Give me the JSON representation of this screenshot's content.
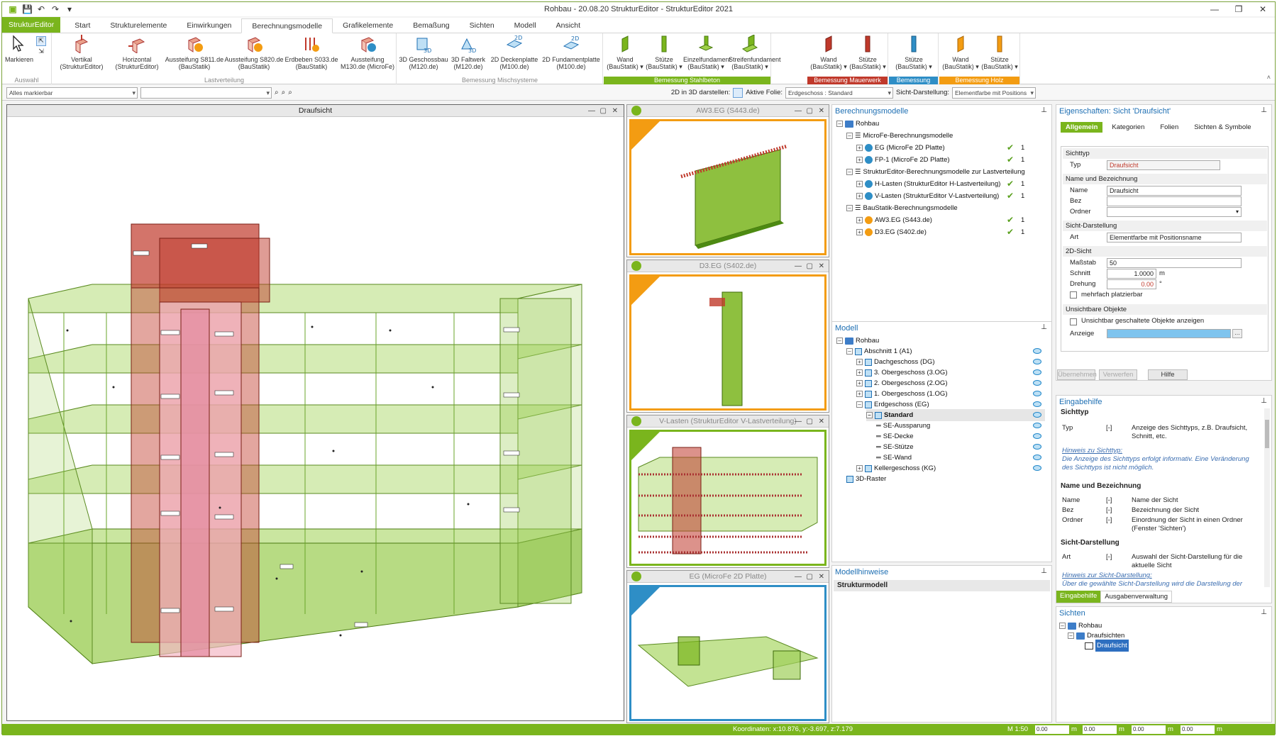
{
  "window": {
    "title": "Rohbau - 20.08.20 StrukturEditor - StrukturEditor 2021",
    "controls": [
      "—",
      "❐",
      "✕"
    ]
  },
  "quick_access": {
    "save_icon": "save-icon",
    "undo_icon": "undo-icon",
    "redo_icon": "redo-icon",
    "customize_icon": "customize-icon"
  },
  "tabs": [
    "StrukturEditor",
    "Start",
    "Strukturelemente",
    "Einwirkungen",
    "Berechnungsmodelle",
    "Grafikelemente",
    "Bemaßung",
    "Sichten",
    "Modell",
    "Ansicht"
  ],
  "active_tab": "Berechnungsmodelle",
  "ribbon": {
    "auswahl": {
      "label": "Auswahl",
      "markieren": "Markieren"
    },
    "lastverteilung": {
      "label": "Lastverteilung",
      "buttons": [
        {
          "l1": "Vertikal",
          "l2": "(StrukturEditor)"
        },
        {
          "l1": "Horizontal",
          "l2": "(StrukturEditor)"
        },
        {
          "l1": "Aussteifung S811.de",
          "l2": "(BauStatik)"
        },
        {
          "l1": "Aussteifung S820.de",
          "l2": "(BauStatik)"
        },
        {
          "l1": "Erdbeben S033.de",
          "l2": "(BauStatik)"
        },
        {
          "l1": "Aussteifung",
          "l2": "M130.de (MicroFe)"
        }
      ]
    },
    "mischsysteme": {
      "label": "Bemessung Mischsysteme",
      "buttons": [
        {
          "l1": "3D Geschossbau",
          "l2": "(M120.de)"
        },
        {
          "l1": "3D Faltwerk",
          "l2": "(M120.de)"
        },
        {
          "l1": "2D Deckenplatte",
          "l2": "(M100.de)"
        },
        {
          "l1": "2D Fundamentplatte",
          "l2": "(M100.de)"
        }
      ]
    },
    "stahlbeton": {
      "label": "Bemessung Stahlbeton",
      "color": "#7ab51d",
      "buttons": [
        {
          "l1": "Wand",
          "l2": "(BauStatik) ▾"
        },
        {
          "l1": "Stütze",
          "l2": "(BauStatik) ▾"
        },
        {
          "l1": "Einzelfundament",
          "l2": "(BauStatik) ▾"
        },
        {
          "l1": "Streifenfundament",
          "l2": "(BauStatik) ▾"
        }
      ]
    },
    "mauerwerk": {
      "label": "Bemessung Mauerwerk",
      "color": "#c0392b",
      "buttons": [
        {
          "l1": "Wand",
          "l2": "(BauStatik) ▾"
        },
        {
          "l1": "Stütze",
          "l2": "(BauStatik) ▾"
        }
      ]
    },
    "stahl": {
      "label": "Bemessung Stahl",
      "color": "#2e8ec6",
      "buttons": [
        {
          "l1": "Stütze",
          "l2": "(BauStatik) ▾"
        }
      ]
    },
    "holz": {
      "label": "Bemessung Holz",
      "color": "#f39c12",
      "buttons": [
        {
          "l1": "Wand",
          "l2": "(BauStatik) ▾"
        },
        {
          "l1": "Stütze",
          "l2": "(BauStatik) ▾"
        }
      ]
    }
  },
  "toolbar": {
    "selection_combo": "Alles markierbar",
    "second_combo": "",
    "show_3d": "2D in 3D darstellen:",
    "active_layer_label": "Aktive Folie:",
    "active_layer_value": "Erdgeschoss : Standard",
    "view_mode_label": "Sicht-Darstellung:",
    "view_mode_value": "Elementfarbe mit Positions"
  },
  "main_view": {
    "title": "Draufsicht"
  },
  "mini_views": [
    {
      "title": "AW3.EG (S443.de)",
      "accent": "#f39c12"
    },
    {
      "title": "D3.EG (S402.de)",
      "accent": "#f39c12"
    },
    {
      "title": "V-Lasten (StrukturEditor V-Lastverteilung)",
      "accent": "#7ab51d"
    },
    {
      "title": "EG (MicroFe 2D Platte)",
      "accent": "#2e8ec6"
    }
  ],
  "berechnungsmodelle": {
    "title": "Berechnungsmodelle",
    "rows": [
      {
        "label": "Rohbau",
        "indent": 0,
        "checked": false,
        "count": ""
      },
      {
        "label": "MicroFe-Berechnungsmodelle",
        "indent": 1,
        "checked": false,
        "count": ""
      },
      {
        "label": "EG (MicroFe 2D Platte)",
        "indent": 2,
        "checked": true,
        "count": "1"
      },
      {
        "label": "FP-1 (MicroFe 2D Platte)",
        "indent": 2,
        "checked": true,
        "count": "1"
      },
      {
        "label": "StrukturEditor-Berechnungsmodelle zur Lastverteilung",
        "indent": 1,
        "checked": false,
        "count": ""
      },
      {
        "label": "H-Lasten (StrukturEditor H-Lastverteilung)",
        "indent": 2,
        "checked": true,
        "count": "1"
      },
      {
        "label": "V-Lasten (StrukturEditor V-Lastverteilung)",
        "indent": 2,
        "checked": true,
        "count": "1"
      },
      {
        "label": "BauStatik-Berechnungsmodelle",
        "indent": 1,
        "checked": false,
        "count": ""
      },
      {
        "label": "AW3.EG (S443.de)",
        "indent": 2,
        "checked": true,
        "count": "1"
      },
      {
        "label": "D3.EG (S402.de)",
        "indent": 2,
        "checked": true,
        "count": "1"
      }
    ]
  },
  "modell": {
    "title": "Modell",
    "rows": [
      {
        "label": "Rohbau",
        "indent": 0
      },
      {
        "label": "Abschnitt 1 (A1)",
        "indent": 1
      },
      {
        "label": "Dachgeschoss (DG)",
        "indent": 2
      },
      {
        "label": "3. Obergeschoss (3.OG)",
        "indent": 2
      },
      {
        "label": "2. Obergeschoss (2.OG)",
        "indent": 2
      },
      {
        "label": "1. Obergeschoss (1.OG)",
        "indent": 2
      },
      {
        "label": "Erdgeschoss (EG)",
        "indent": 2
      },
      {
        "label": "Standard",
        "indent": 3
      },
      {
        "label": "SE-Aussparung",
        "indent": 4
      },
      {
        "label": "SE-Decke",
        "indent": 4
      },
      {
        "label": "SE-Stütze",
        "indent": 4
      },
      {
        "label": "SE-Wand",
        "indent": 4
      },
      {
        "label": "Kellergeschoss (KG)",
        "indent": 2
      },
      {
        "label": "3D-Raster",
        "indent": 1
      }
    ]
  },
  "modellhinweise": {
    "title": "Modellhinweise",
    "column": "Strukturmodell"
  },
  "eigenschaften": {
    "title": "Eigenschaften: Sicht 'Draufsicht'",
    "tabs": [
      "Allgemein",
      "Kategorien",
      "Folien",
      "Sichten & Symbole"
    ],
    "sichttyp": {
      "section": "Sichttyp",
      "typ_label": "Typ",
      "typ_value": "Draufsicht"
    },
    "name": {
      "section": "Name und Bezeichnung",
      "name_label": "Name",
      "name_value": "Draufsicht",
      "bez_label": "Bez",
      "ordner_label": "Ordner"
    },
    "darstellung": {
      "section": "Sicht-Darstellung",
      "art_label": "Art",
      "art_value": "Elementfarbe mit Positionsname"
    },
    "sicht2d": {
      "section": "2D-Sicht",
      "massstab_label": "Maßstab",
      "massstab_value": "50",
      "schnitt_label": "Schnitt",
      "schnitt_value": "1.0000",
      "schnitt_unit": "m",
      "drehung_label": "Drehung",
      "drehung_value": "0.00",
      "drehung_unit": "°",
      "mehrfach": "mehrfach platzierbar"
    },
    "unsichtbar": {
      "section": "Unsichtbare Objekte",
      "check_label": "Unsichtbar geschaltete Objekte anzeigen",
      "anzeige_label": "Anzeige",
      "anzeige_color": "#7fc4ee"
    },
    "buttons": [
      "Übernehmen",
      "Verwerfen",
      "Hilfe"
    ]
  },
  "eingabehilfe": {
    "title": "Eingabehilfe",
    "h1": "Sichttyp",
    "typ": {
      "k": "Typ",
      "u": "[-]",
      "d": "Anzeige des Sichttyps, z.B. Draufsicht, Schnitt, etc."
    },
    "hinweis1_title": "Hinweis zu Sichttyp:",
    "hinweis1": "Die Anzeige des Sichttyps erfolgt informativ. Eine Veränderung des Sichttyps ist nicht möglich.",
    "h2": "Name und Bezeichnung",
    "name": {
      "k": "Name",
      "u": "[-]",
      "d": "Name der Sicht"
    },
    "bez": {
      "k": "Bez",
      "u": "[-]",
      "d": "Bezeichnung der Sicht"
    },
    "ordner": {
      "k": "Ordner",
      "u": "[-]",
      "d": "Einordnung der Sicht in einen Ordner (Fenster 'Sichten')"
    },
    "h3": "Sicht-Darstellung",
    "art": {
      "k": "Art",
      "u": "[-]",
      "d": "Auswahl der Sicht-Darstellung für die aktuelle Sicht"
    },
    "hinweis2_title": "Hinweis zur Sicht-Darstellung:",
    "hinweis2": "Über die gewählte Sicht-Darstellung wird die Darstellung der",
    "bottom_tabs": [
      "Eingabehilfe",
      "Ausgabenverwaltung"
    ]
  },
  "sichten": {
    "title": "Sichten",
    "rows": [
      "Rohbau",
      "Draufsichten",
      "Draufsicht"
    ]
  },
  "status": {
    "coords": "Koordinaten: x:10.876, y:-3.697, z:7.179",
    "scale": "M 1:50",
    "fields": [
      "0.00",
      "0.00",
      "0.00",
      "0.00"
    ],
    "units": [
      "m",
      "m",
      "m",
      "m"
    ]
  }
}
